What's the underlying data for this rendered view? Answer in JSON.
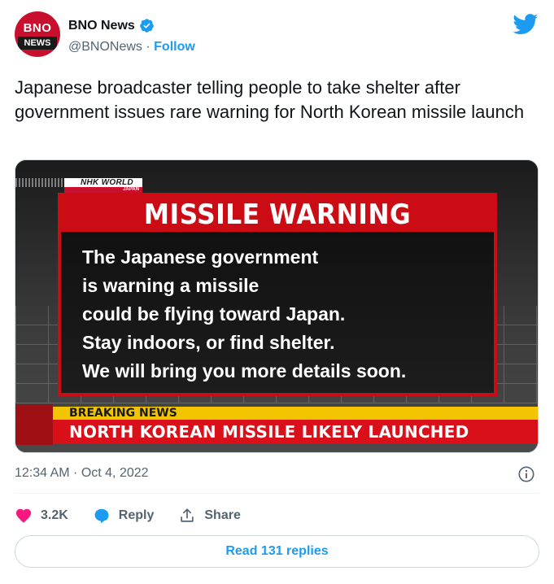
{
  "account": {
    "avatar_text_top": "BNO",
    "avatar_text_bottom": "NEWS",
    "name": "BNO News",
    "handle": "@BNONews",
    "separator": " · ",
    "follow_label": "Follow"
  },
  "tweet": {
    "text": "Japanese broadcaster telling people to take shelter after government issues rare warning for North Korean missile launch",
    "timestamp": "12:34 AM · Oct 4, 2022"
  },
  "media": {
    "nhk_logo_top": "NHK WORLD",
    "nhk_logo_bottom": "JAPAN",
    "warning_title": "MISSILE WARNING",
    "warning_lines": [
      "The Japanese government",
      "is warning a missile",
      "could be flying toward Japan.",
      "Stay indoors, or find shelter.",
      "We will bring you more details soon."
    ],
    "breaking_label": "BREAKING NEWS",
    "headline": "NORTH KOREAN MISSILE LIKELY LAUNCHED"
  },
  "actions": {
    "like_count": "3.2K",
    "reply_label": "Reply",
    "share_label": "Share"
  },
  "read_replies_label": "Read 131 replies",
  "colors": {
    "twitter_blue": "#1d9bf0",
    "like_pink": "#f91880",
    "warning_red": "#cc0c15",
    "breaking_yellow": "#f2c500"
  },
  "icons": [
    "verified-badge-icon",
    "twitter-bird-icon",
    "info-icon",
    "heart-icon",
    "reply-bubble-icon",
    "share-icon"
  ]
}
